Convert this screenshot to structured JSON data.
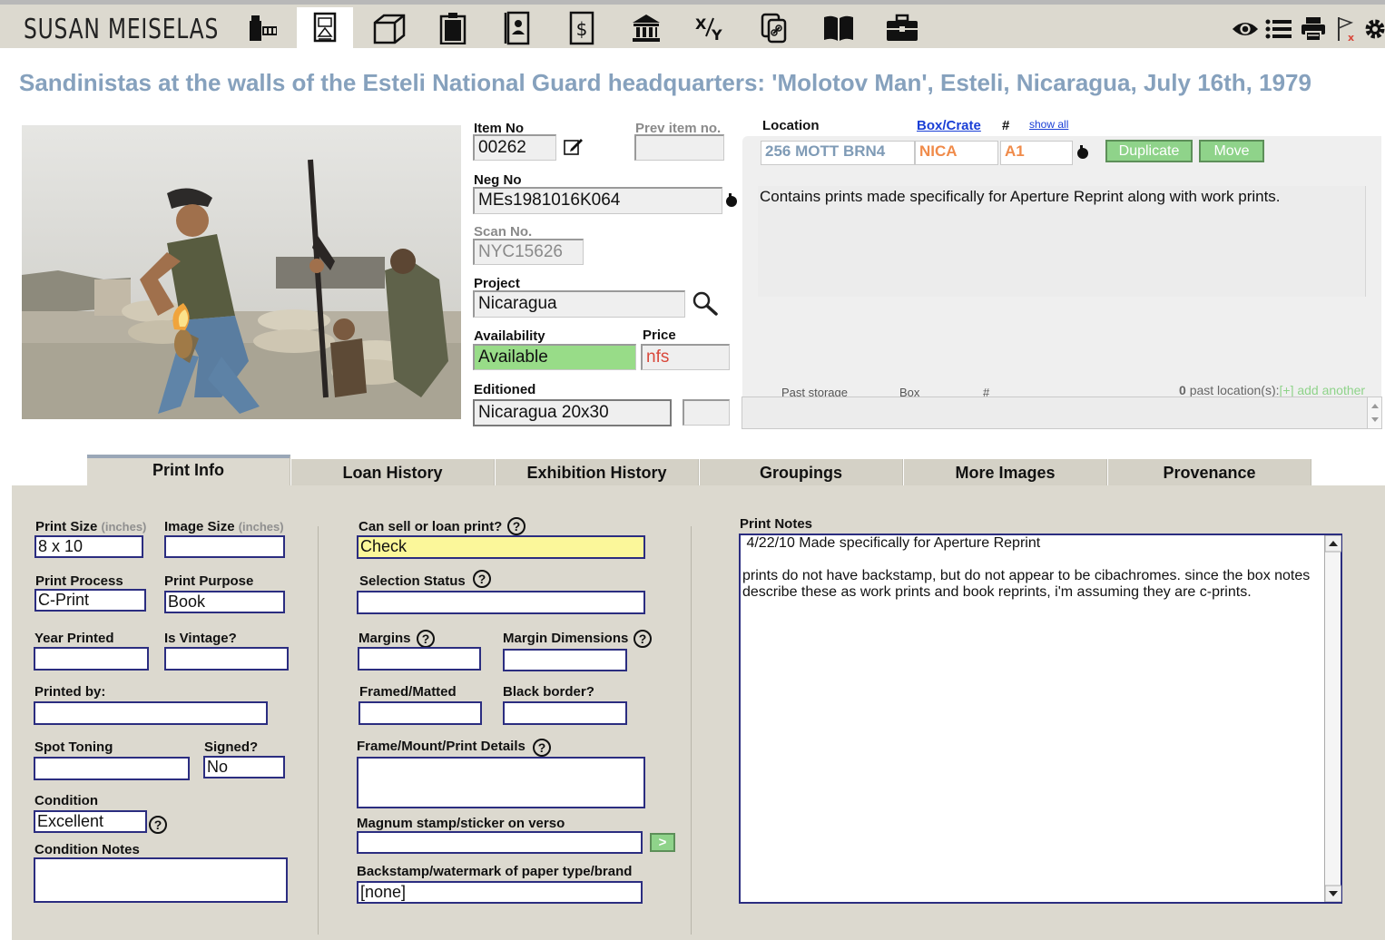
{
  "header": {
    "brand": "SUSAN MEISELAS",
    "nav_icons": [
      "film-strip-icon",
      "print-icon",
      "box-icon",
      "clipboard-icon",
      "contact-icon",
      "invoice-dollar-icon",
      "museum-icon",
      "ratio-icon",
      "copy-link-icon",
      "book-icon",
      "briefcase-icon"
    ],
    "active_icon": "print-icon",
    "tool_icons": [
      "eye-icon",
      "list-icon",
      "printer-icon",
      "flag-x-icon",
      "gear-icon"
    ]
  },
  "title": "Sandinistas at the walls of the Esteli National Guard headquarters: 'Molotov Man', Esteli, Nicaragua, July 16th, 1979",
  "record": {
    "item_no_label": "Item No",
    "item_no": "00262",
    "prev_item_label": "Prev item no.",
    "prev_item": "",
    "neg_no_label": "Neg No",
    "neg_no": "MEs1981016K064",
    "scan_no_label": "Scan No.",
    "scan_no": "NYC15626",
    "project_label": "Project",
    "project": "Nicaragua",
    "availability_label": "Availability",
    "availability": "Available",
    "price_label": "Price",
    "price": "nfs",
    "editioned_label": "Editioned",
    "editioned": "Nicaragua 20x30",
    "editioned_extra": ""
  },
  "location": {
    "location_label": "Location",
    "box_label": "Box/Crate",
    "num_label": "#",
    "show_all": "show all",
    "location": "256 MOTT BRN4",
    "box": "NICA",
    "num": "A1",
    "duplicate_btn": "Duplicate",
    "move_btn": "Move",
    "notes": "Contains prints made specifically for Aperture Reprint along with work prints.",
    "past_storage_label": "Past storage",
    "past_box_label": "Box",
    "past_num_label": "#",
    "past_count": "0",
    "past_text": "past location(s):",
    "add_another": "[+] add another"
  },
  "tabs": [
    "Print Info",
    "Loan History",
    "Exhibition History",
    "Groupings",
    "More Images",
    "Provenance"
  ],
  "form": {
    "print_size_label": "Print Size",
    "inches": "(inches)",
    "print_size": "8 x 10",
    "image_size_label": "Image Size",
    "image_size": "",
    "print_process_label": "Print Process",
    "print_process": "C-Print",
    "print_purpose_label": "Print Purpose",
    "print_purpose": "Book",
    "year_printed_label": "Year Printed",
    "year_printed": "",
    "is_vintage_label": "Is Vintage?",
    "is_vintage": "",
    "printed_by_label": "Printed by:",
    "printed_by": "",
    "spot_toning_label": "Spot Toning",
    "spot_toning": "",
    "signed_label": "Signed?",
    "signed": "No",
    "condition_label": "Condition",
    "condition": "Excellent",
    "condition_notes_label": "Condition Notes",
    "condition_notes": "",
    "can_sell_label": "Can sell or loan print?",
    "can_sell": "Check",
    "selection_status_label": "Selection Status",
    "selection_status": "",
    "margins_label": "Margins",
    "margins": "",
    "margin_dims_label": "Margin Dimensions",
    "margin_dims": "",
    "framed_label": "Framed/Matted",
    "framed": "",
    "black_border_label": "Black border?",
    "black_border": "",
    "frame_details_label": "Frame/Mount/Print Details",
    "frame_details": "",
    "magnum_label": "Magnum stamp/sticker on verso",
    "magnum": "",
    "magnum_go": ">",
    "backstamp_label": "Backstamp/watermark of paper type/brand",
    "backstamp": "[none]",
    "help_glyph": "?",
    "print_notes_label": "Print Notes",
    "print_notes": " 4/22/10 Made specifically for Aperture Reprint\n\nprints do not have backstamp, but do not appear to be cibachromes. since the box notes describe these as work prints and book reprints, i'm assuming they are c-prints."
  },
  "colors": {
    "title": "#86a1bd",
    "panel_bg": "#dcd9cf",
    "available_green": "#98dc88",
    "check_yellow": "#fbf79a",
    "button_green": "#8fd38a",
    "location_blue_text": "#7f9bb6",
    "box_orange_text": "#f08b4a",
    "price_red": "#d9483b",
    "field_border": "#2b2d80"
  }
}
